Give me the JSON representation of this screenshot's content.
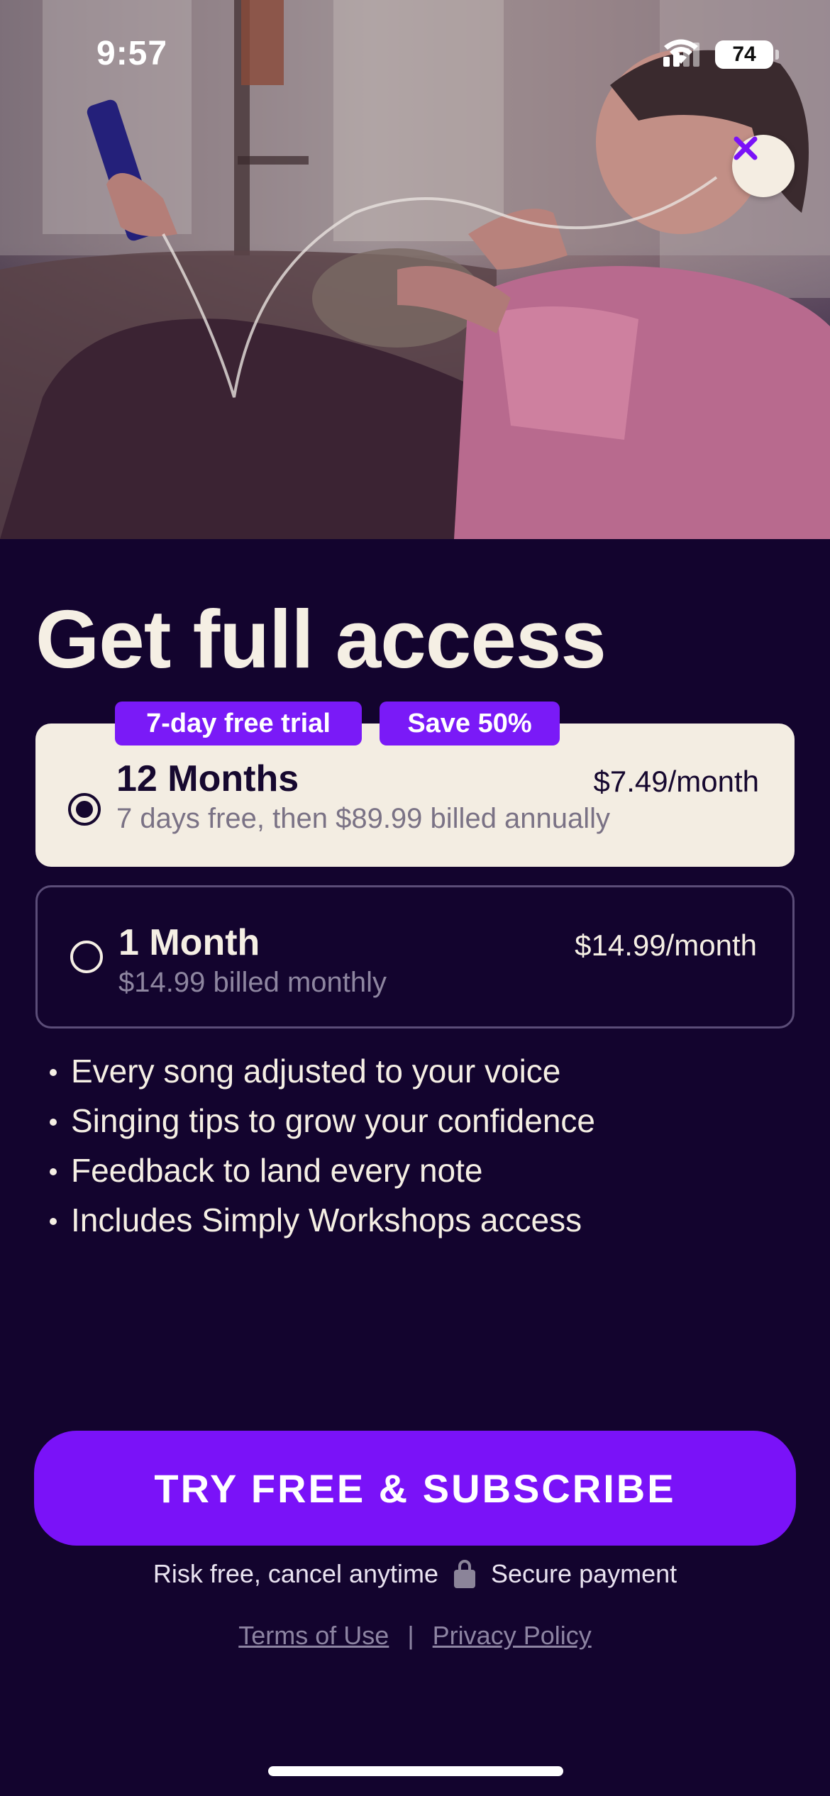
{
  "status_bar": {
    "time": "9:57",
    "battery": "74"
  },
  "hero": {
    "image_alt": "woman singing with headphones"
  },
  "title": "Get full access",
  "badges": {
    "trial": "7-day free trial",
    "save": "Save 50%"
  },
  "plans": [
    {
      "name": "12 Months",
      "price": "$7.49/month",
      "subtitle": "7 days free, then $89.99 billed annually",
      "selected": true
    },
    {
      "name": "1 Month",
      "price": "$14.99/month",
      "subtitle": "$14.99 billed monthly",
      "selected": false
    }
  ],
  "features": [
    "Every song adjusted to your voice",
    "Singing tips to grow your confidence",
    "Feedback to land every note",
    "Includes Simply Workshops access"
  ],
  "cta": "TRY FREE & SUBSCRIBE",
  "assurance": {
    "left": "Risk free, cancel anytime",
    "right": "Secure payment"
  },
  "legal": {
    "terms": "Terms of Use",
    "separator": "|",
    "privacy": "Privacy Policy"
  },
  "colors": {
    "background": "#13042e",
    "accent": "#7a12f8",
    "card_selected": "#f3ede2",
    "text_light": "#f5efe4"
  },
  "icons": [
    "close-icon",
    "lock-icon",
    "wifi-icon",
    "signal-icon",
    "battery-icon"
  ]
}
